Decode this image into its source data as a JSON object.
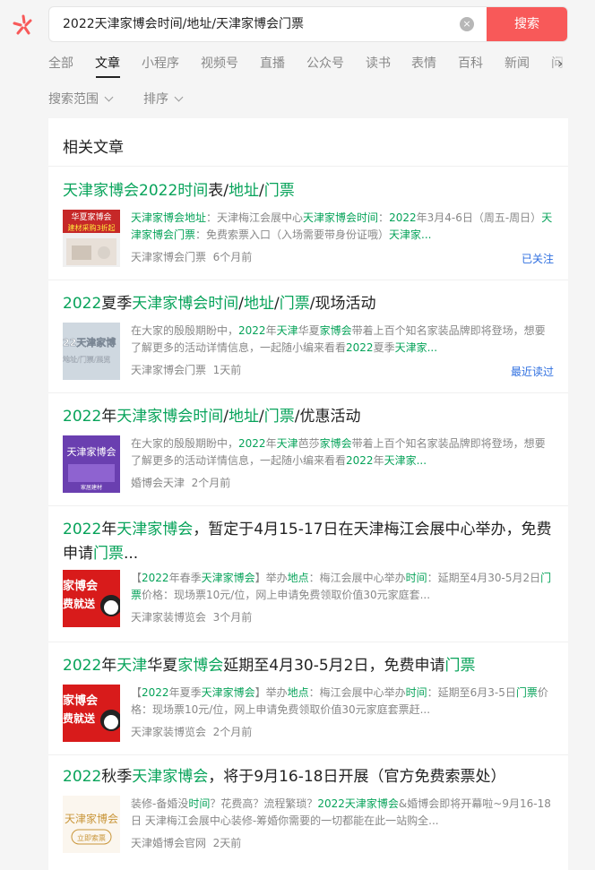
{
  "search": {
    "query": "2022天津家博会时间/地址/天津家博会门票",
    "button": "搜索",
    "clear": "×"
  },
  "tabs": [
    "全部",
    "文章",
    "小程序",
    "视频号",
    "直播",
    "公众号",
    "读书",
    "表情",
    "百科",
    "新闻",
    "问"
  ],
  "active_tab": "文章",
  "tab_next": "›",
  "filters": [
    "搜索范围",
    "排序"
  ],
  "section_title": "相关文章",
  "results": [
    {
      "title": [
        [
          "天津家博会",
          "g"
        ],
        [
          "2022",
          "g"
        ],
        [
          "时间",
          "g"
        ],
        [
          "表/",
          ""
        ],
        [
          "地址",
          "g"
        ],
        [
          "/",
          ""
        ],
        [
          "门票",
          "g"
        ]
      ],
      "snippet": [
        [
          "天津家博会地址",
          "g"
        ],
        [
          "：天津梅江会展中心",
          ""
        ],
        [
          "天津家博会时间",
          "g"
        ],
        [
          "：",
          ""
        ],
        [
          "2022",
          "g"
        ],
        [
          "年3月4-6日（周五-周日）",
          ""
        ],
        [
          "天津家博会门票",
          "g"
        ],
        [
          "：免费索票入口（入场需要带身份证哦）",
          ""
        ],
        [
          "天津家...",
          "g"
        ]
      ],
      "source": "天津家博会门票",
      "time": "6个月前",
      "tag": "已关注",
      "thumb": {
        "line1": "华夏家博会",
        "line2": "建材采购3折起"
      }
    },
    {
      "title": [
        [
          "2022",
          "g"
        ],
        [
          "夏季",
          ""
        ],
        [
          "天津家博会",
          "g"
        ],
        [
          "时间",
          "g"
        ],
        [
          "/",
          ""
        ],
        [
          "地址",
          "g"
        ],
        [
          "/",
          ""
        ],
        [
          "门票",
          "g"
        ],
        [
          "/现场活动",
          ""
        ]
      ],
      "snippet": [
        [
          "在大家的殷殷期盼中，",
          ""
        ],
        [
          "2022",
          "g"
        ],
        [
          "年",
          ""
        ],
        [
          "天津",
          "g"
        ],
        [
          "华夏",
          ""
        ],
        [
          "家博会",
          "g"
        ],
        [
          "带着上百个知名家装品牌即将登场，想要了解更多的活动详情信息，一起随小编来看看",
          ""
        ],
        [
          "2022",
          "g"
        ],
        [
          "夏季",
          ""
        ],
        [
          "天津家...",
          "g"
        ]
      ],
      "source": "天津家博会门票",
      "time": "1天前",
      "tag": "最近读过",
      "thumb": {
        "line1": "22天津家博",
        "line2": "地址/门票/展览"
      }
    },
    {
      "title": [
        [
          "2022",
          "g"
        ],
        [
          "年",
          ""
        ],
        [
          "天津家博会",
          "g"
        ],
        [
          "时间",
          "g"
        ],
        [
          "/",
          ""
        ],
        [
          "地址",
          "g"
        ],
        [
          "/",
          ""
        ],
        [
          "门票",
          "g"
        ],
        [
          "/优惠活动",
          ""
        ]
      ],
      "snippet": [
        [
          "在大家的殷殷期盼中，",
          ""
        ],
        [
          "2022",
          "g"
        ],
        [
          "年",
          ""
        ],
        [
          "天津",
          "g"
        ],
        [
          "芭莎",
          ""
        ],
        [
          "家博会",
          "g"
        ],
        [
          "带着上百个知名家装品牌即将登场，想要了解更多的活动详情信息，一起随小编来看看",
          ""
        ],
        [
          "2022",
          "g"
        ],
        [
          "年",
          ""
        ],
        [
          "天津家...",
          "g"
        ]
      ],
      "source": "婚博会天津",
      "time": "2个月前",
      "tag": "",
      "thumb": {
        "line1": "天津家博会",
        "line2": "家居建材"
      }
    },
    {
      "title": [
        [
          "2022",
          "g"
        ],
        [
          "年",
          ""
        ],
        [
          "天津家博会",
          "g"
        ],
        [
          "，暂定于4月15-17日在天津梅江会展中心举办，免费申请",
          ""
        ],
        [
          "门票",
          "g"
        ],
        [
          "...",
          ""
        ]
      ],
      "snippet": [
        [
          "【",
          ""
        ],
        [
          "2022",
          "g"
        ],
        [
          "年春季",
          ""
        ],
        [
          "天津家博会",
          "g"
        ],
        [
          "】举办",
          ""
        ],
        [
          "地点",
          "g"
        ],
        [
          "：梅江会展中心举办",
          ""
        ],
        [
          "时间",
          "g"
        ],
        [
          "：延期至4月30-5月2日",
          ""
        ],
        [
          "门票",
          "g"
        ],
        [
          "价格：现场票10元/位，网上申请免费领取价值30元家庭套...",
          ""
        ]
      ],
      "source": "天津家装博览会",
      "time": "3个月前",
      "tag": "",
      "thumb": {
        "line1": "家博会",
        "line2": "费就送"
      }
    },
    {
      "title": [
        [
          "2022",
          "g"
        ],
        [
          "年",
          ""
        ],
        [
          "天津",
          "g"
        ],
        [
          "华夏",
          ""
        ],
        [
          "家博会",
          "g"
        ],
        [
          "延期至4月30-5月2日，免费申请",
          ""
        ],
        [
          "门票",
          "g"
        ]
      ],
      "snippet": [
        [
          "【",
          ""
        ],
        [
          "2022",
          "g"
        ],
        [
          "年夏季",
          ""
        ],
        [
          "天津家博会",
          "g"
        ],
        [
          "】举办",
          ""
        ],
        [
          "地点",
          "g"
        ],
        [
          "：梅江会展中心举办",
          ""
        ],
        [
          "时间",
          "g"
        ],
        [
          "：延期至6月3-5日",
          ""
        ],
        [
          "门票",
          "g"
        ],
        [
          "价格：现场票10元/位，网上申请免费领取价值30元家庭套票赶...",
          ""
        ]
      ],
      "source": "天津家装博览会",
      "time": "2个月前",
      "tag": "",
      "thumb": {
        "line1": "家博会",
        "line2": "费就送"
      }
    },
    {
      "title": [
        [
          "2022",
          "g"
        ],
        [
          "秋季",
          ""
        ],
        [
          "天津家博会",
          "g"
        ],
        [
          "，将于9月16-18日开展（官方免费索票处）",
          ""
        ]
      ],
      "snippet": [
        [
          "装修-备婚没",
          ""
        ],
        [
          "时间",
          "g"
        ],
        [
          "？花费高？流程繁琐？",
          ""
        ],
        [
          "2022天津家博会",
          "g"
        ],
        [
          "&婚博会即将开幕啦~9月16-18日 天津梅江会展中心装修-筹婚你需要的一切都能在此一站购全...",
          ""
        ]
      ],
      "source": "天津婚博会官网",
      "time": "2天前",
      "tag": "",
      "thumb": {
        "line1": "天津家博会",
        "line2": "立即索票"
      }
    }
  ]
}
